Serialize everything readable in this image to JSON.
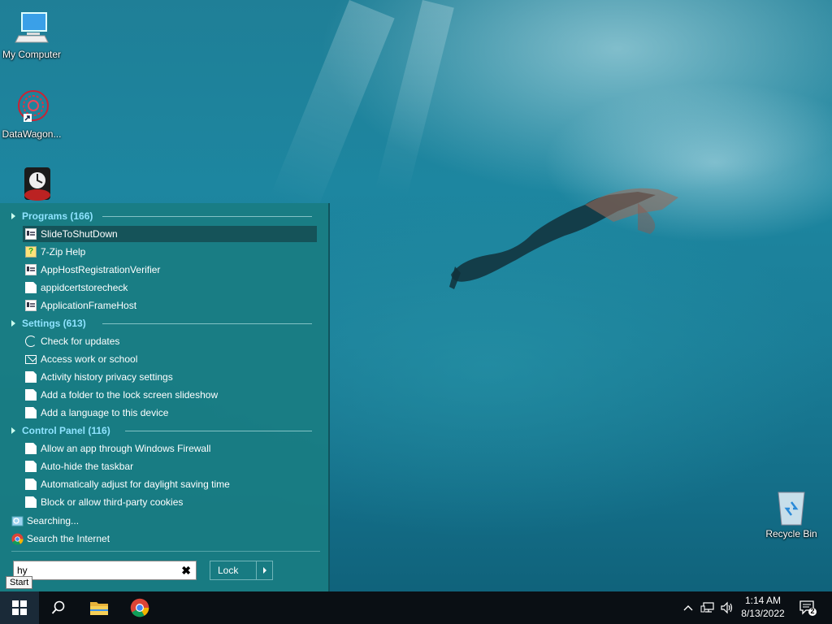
{
  "desktop": {
    "icons": [
      {
        "label": "My Computer",
        "icon": "computer-icon"
      },
      {
        "label": "DataWagon...",
        "icon": "datawagon-icon"
      },
      {
        "label": "",
        "icon": "poker-chip-icon"
      },
      {
        "label": "Recycle Bin",
        "icon": "recycle-bin-icon"
      }
    ]
  },
  "start_menu": {
    "categories": [
      {
        "label": "Programs (166)"
      },
      {
        "label": "Settings (613)"
      },
      {
        "label": "Control Panel (116)"
      }
    ],
    "programs": [
      {
        "label": "SlideToShutDown",
        "icon": "app-icon",
        "selected": true
      },
      {
        "label": "7-Zip Help",
        "icon": "help-icon"
      },
      {
        "label": "AppHostRegistrationVerifier",
        "icon": "app-icon"
      },
      {
        "label": "appidcertstorecheck",
        "icon": "document-icon"
      },
      {
        "label": "ApplicationFrameHost",
        "icon": "app-icon"
      }
    ],
    "settings": [
      {
        "label": "Check for updates",
        "icon": "refresh-icon"
      },
      {
        "label": "Access work or school",
        "icon": "briefcase-icon"
      },
      {
        "label": "Activity history privacy settings",
        "icon": "document-icon"
      },
      {
        "label": "Add a folder to the lock screen slideshow",
        "icon": "document-icon"
      },
      {
        "label": "Add a language to this device",
        "icon": "document-icon"
      }
    ],
    "control_panel": [
      {
        "label": "Allow an app through Windows Firewall",
        "icon": "document-icon"
      },
      {
        "label": "Auto-hide the taskbar",
        "icon": "document-icon"
      },
      {
        "label": "Automatically adjust for daylight saving time",
        "icon": "document-icon"
      },
      {
        "label": "Block or allow third-party cookies",
        "icon": "document-icon"
      }
    ],
    "searching_label": "Searching...",
    "search_internet_label": "Search the Internet",
    "search_value": "hy",
    "lock_label": "Lock",
    "clear_symbol": "✖"
  },
  "tooltip": "Start",
  "taskbar": {
    "time": "1:14 AM",
    "date": "8/13/2022",
    "notification_count": "2",
    "colors": {
      "background": "#0a0f14",
      "start_bg": "#1a2a38"
    }
  }
}
